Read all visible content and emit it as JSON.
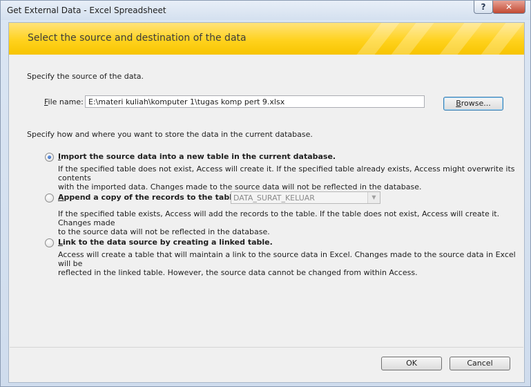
{
  "window": {
    "title": "Get External Data - Excel Spreadsheet",
    "help_label": "?",
    "close_label": "✕"
  },
  "banner": {
    "heading": "Select the source and destination of the data"
  },
  "source": {
    "instruction": "Specify the source of the data.",
    "file_label_u": "F",
    "file_label_rest": "ile name:",
    "file_value": "E:\\materi kuliah\\komputer 1\\tugas komp pert 9.xlsx",
    "browse_u": "B",
    "browse_rest": "rowse..."
  },
  "store": {
    "instruction": "Specify how and where you want to store the data in the current database.",
    "options": [
      {
        "label_u": "I",
        "label_rest": "mport the source data into a new table in the current database.",
        "desc_line1": "If the specified table does not exist, Access will create it. If the specified table already exists, Access might overwrite its contents",
        "desc_line2": "with the imported data. Changes made to the source data will not be reflected in the database.",
        "selected": true
      },
      {
        "label_u": "A",
        "label_rest": "ppend a copy of the records to the table:",
        "select_value": "DATA_SURAT_KELUAR",
        "desc_line1": "If the specified table exists, Access will add the records to the table. If the table does not exist, Access will create it. Changes made",
        "desc_line2": "to the source data will not be reflected in the database.",
        "selected": false
      },
      {
        "label_u": "L",
        "label_rest": "ink to the data source by creating a linked table.",
        "desc_line1": "Access will create a table that will maintain a link to the source data in Excel. Changes made to the source data in Excel will be",
        "desc_line2": "reflected in the linked table. However, the source data cannot be changed from within Access.",
        "selected": false
      }
    ]
  },
  "footer": {
    "ok_label": "OK",
    "cancel_label": "Cancel"
  },
  "icons": {
    "help": "help-icon",
    "close": "close-icon",
    "dropdown": "chevron-down-icon"
  },
  "colors": {
    "banner": "#ffd21e",
    "banner_text": "#3c3c3c",
    "close_button": "#c24a33",
    "dialog_bg": "#f0f0f0",
    "radio_selected": "#1d4fa8"
  }
}
